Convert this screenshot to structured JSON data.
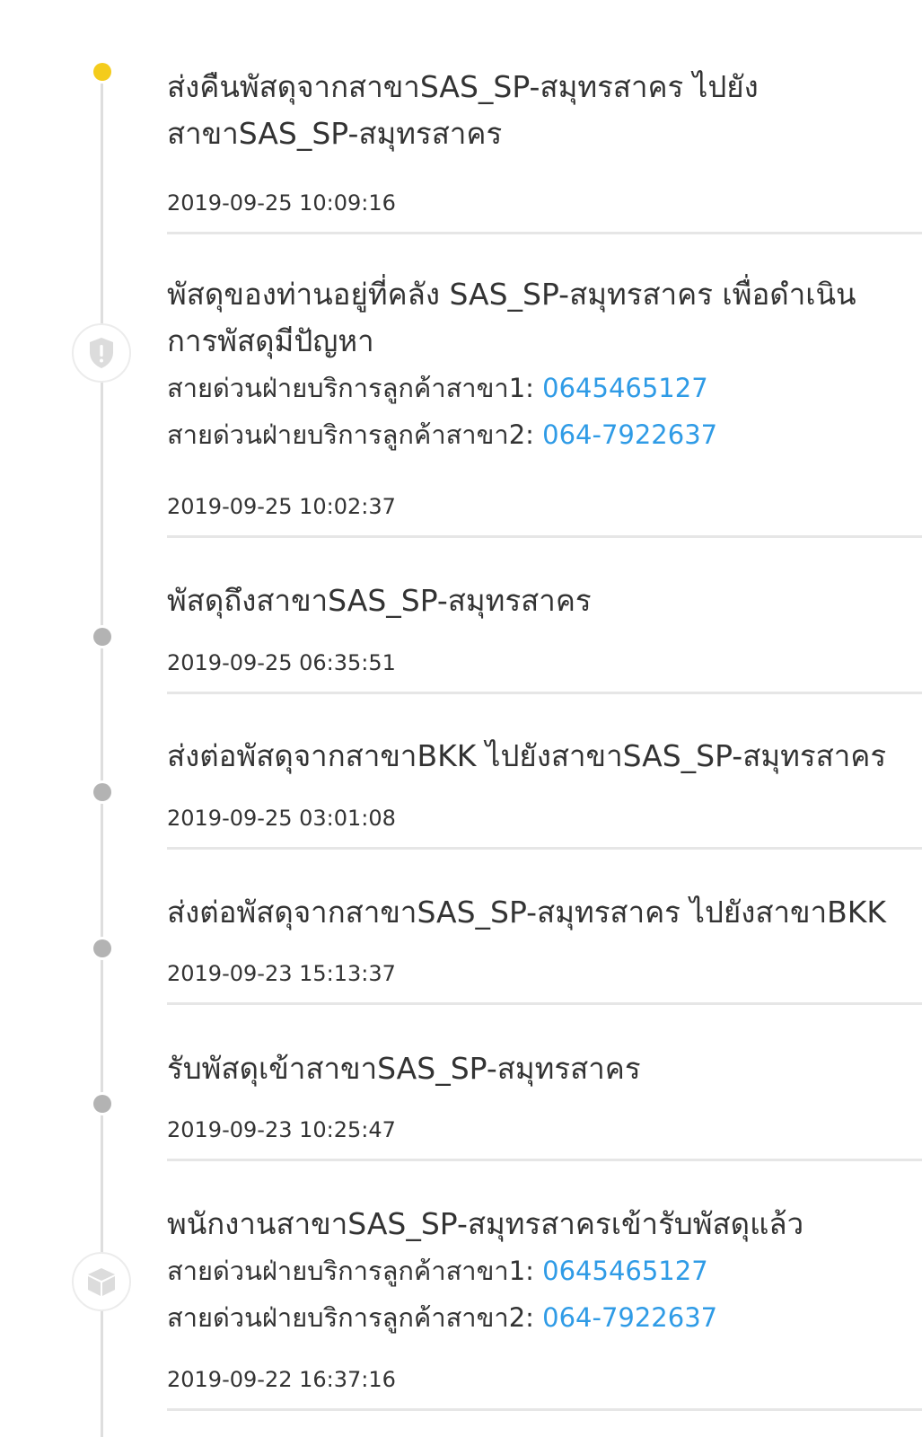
{
  "events": [
    {
      "title": "ส่งคืนพัสดุจากสาขาSAS_SP-สมุทรสาคร ไปยังสาขาSAS_SP-สมุทรสาคร",
      "time": "2019-09-25 10:09:16",
      "status": "current"
    },
    {
      "title": "พัสดุของท่านอยู่ที่คลัง SAS_SP-สมุทรสาคร เพื่อดำเนินการพัสดุมีปัญหา",
      "hotlines": [
        {
          "label": "สายด่วนฝ่ายบริการลูกค้าสาขา1:",
          "phone": "0645465127"
        },
        {
          "label": "สายด่วนฝ่ายบริการลูกค้าสาขา2:",
          "phone": "064-7922637"
        }
      ],
      "time": "2019-09-25 10:02:37",
      "icon": "shield-alert-icon"
    },
    {
      "title": "พัสดุถึงสาขาSAS_SP-สมุทรสาคร",
      "time": "2019-09-25 06:35:51"
    },
    {
      "title": "ส่งต่อพัสดุจากสาขาBKK ไปยังสาขาSAS_SP-สมุทรสาคร",
      "time": "2019-09-25 03:01:08"
    },
    {
      "title": "ส่งต่อพัสดุจากสาขาSAS_SP-สมุทรสาคร ไปยังสาขาBKK",
      "time": "2019-09-23 15:13:37"
    },
    {
      "title": "รับพัสดุเข้าสาขาSAS_SP-สมุทรสาคร",
      "time": "2019-09-23 10:25:47"
    },
    {
      "title": "พนักงานสาขาSAS_SP-สมุทรสาครเข้ารับพัสดุแล้ว",
      "hotlines": [
        {
          "label": "สายด่วนฝ่ายบริการลูกค้าสาขา1:",
          "phone": "0645465127"
        },
        {
          "label": "สายด่วนฝ่ายบริการลูกค้าสาขา2:",
          "phone": "064-7922637"
        }
      ],
      "time": "2019-09-22 16:37:16",
      "icon": "package-icon"
    }
  ],
  "colors": {
    "current_dot": "#f4cc1c",
    "past_dot": "#b3b3b3",
    "link": "#2f9be6",
    "rail": "#dedede",
    "divider": "#e6e6e6"
  }
}
